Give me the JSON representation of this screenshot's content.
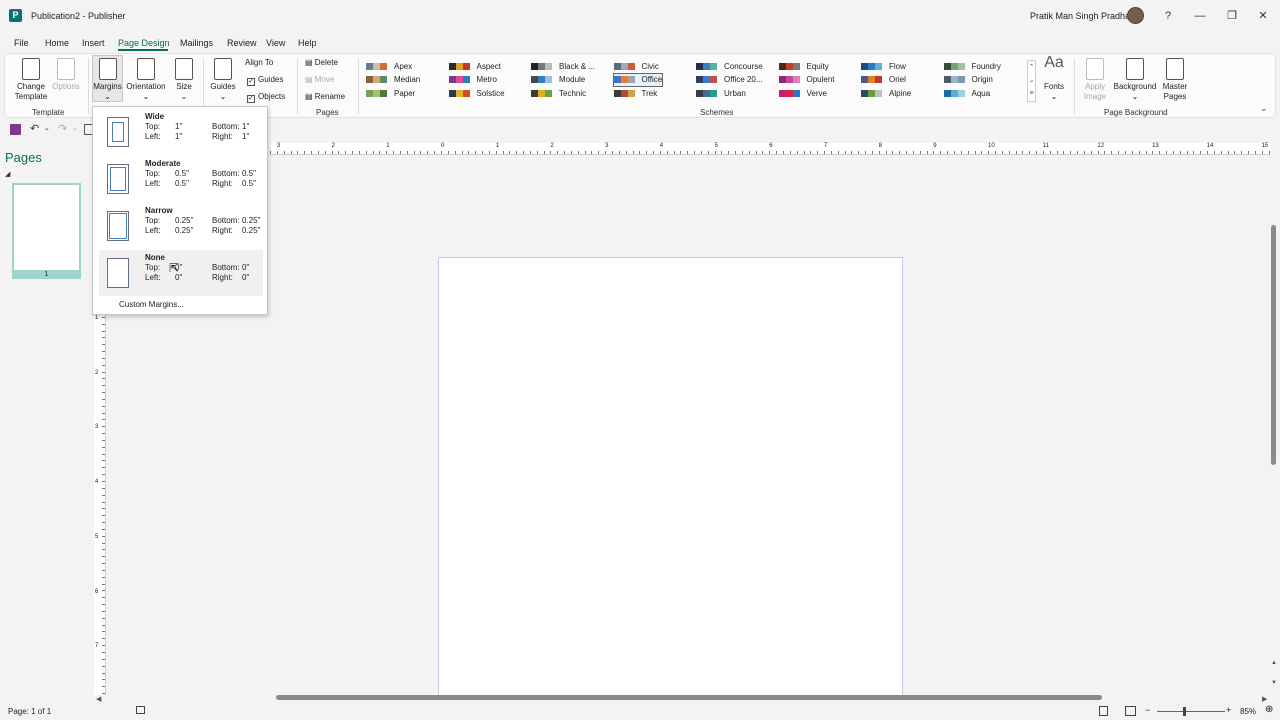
{
  "title_bar": {
    "app_icon_letter": "P",
    "document_title": "Publication2  -  Publisher",
    "user_name": "Pratik Man Singh Pradhan",
    "help": "?",
    "minimize": "—",
    "restore": "❐",
    "close": "✕"
  },
  "menu": {
    "file": "File",
    "home": "Home",
    "insert": "Insert",
    "page_design": "Page Design",
    "mailings": "Mailings",
    "review": "Review",
    "view": "View",
    "help": "Help"
  },
  "ribbon": {
    "template_group": "Template",
    "change_template": "Change Template",
    "options": "Options",
    "margins": "Margins",
    "orientation": "Orientation",
    "size": "Size",
    "guides": "Guides",
    "align_to": "Align To",
    "align_guides": "Guides",
    "align_objects": "Objects",
    "delete": "Delete",
    "move": "Move",
    "rename": "Rename",
    "pages_group": "Pages",
    "schemes_group": "Schemes",
    "fonts": "Fonts",
    "apply_image": "Apply Image",
    "background": "Background",
    "master_pages": "Master Pages",
    "page_background_group": "Page Background",
    "schemes": [
      {
        "name": "Apex",
        "colors": [
          "#6f7a8a",
          "#c9c1a7",
          "#d46b3a"
        ]
      },
      {
        "name": "Median",
        "colors": [
          "#8b5e3c",
          "#d6a96b",
          "#5a8b6e"
        ]
      },
      {
        "name": "Paper",
        "colors": [
          "#7aa05a",
          "#a6c16b",
          "#4e7a3a"
        ]
      },
      {
        "name": "Aspect",
        "colors": [
          "#2b2b2b",
          "#e0a020",
          "#c0392b"
        ]
      },
      {
        "name": "Metro",
        "colors": [
          "#7a3b8f",
          "#e04a9b",
          "#2c7ab8"
        ]
      },
      {
        "name": "Solstice",
        "colors": [
          "#2f3b4a",
          "#e8b030",
          "#d0502a"
        ]
      },
      {
        "name": "Black & ...",
        "colors": [
          "#222222",
          "#777777",
          "#bbbbbb"
        ]
      },
      {
        "name": "Module",
        "colors": [
          "#4a4a4a",
          "#2f7fbf",
          "#9fc0e0"
        ]
      },
      {
        "name": "Technic",
        "colors": [
          "#3a3a3a",
          "#e0b020",
          "#6aa040"
        ]
      },
      {
        "name": "Civic",
        "colors": [
          "#5a6a7a",
          "#9aaaba",
          "#c95a3a"
        ]
      },
      {
        "name": "Office",
        "colors": [
          "#4472c4",
          "#ed7d31",
          "#a5a5a5"
        ]
      },
      {
        "name": "Trek",
        "colors": [
          "#3a3a3a",
          "#b04a2a",
          "#d0a050"
        ]
      },
      {
        "name": "Concourse",
        "colors": [
          "#2a2a4a",
          "#3a7abf",
          "#5ab0a0"
        ]
      },
      {
        "name": "Office 20...",
        "colors": [
          "#2f3f5f",
          "#3c78d8",
          "#c0504d"
        ]
      },
      {
        "name": "Urban",
        "colors": [
          "#3a3a4a",
          "#4a6a9a",
          "#2a9a8a"
        ]
      },
      {
        "name": "Equity",
        "colors": [
          "#4a2a1a",
          "#c0402a",
          "#7a7a7a"
        ]
      },
      {
        "name": "Opulent",
        "colors": [
          "#8a2a7a",
          "#c04a9a",
          "#e07ac0"
        ]
      },
      {
        "name": "Verve",
        "colors": [
          "#c0207a",
          "#e02040",
          "#2a7abf"
        ]
      },
      {
        "name": "Flow",
        "colors": [
          "#1a4a8a",
          "#2a7abf",
          "#5ab0e0"
        ]
      },
      {
        "name": "Oriel",
        "colors": [
          "#4a5a8a",
          "#e0802a",
          "#c03a2a"
        ]
      },
      {
        "name": "Alpine",
        "colors": [
          "#2a4a6a",
          "#6a9a3a",
          "#c0c0c0"
        ]
      },
      {
        "name": "Foundry",
        "colors": [
          "#3a4a3a",
          "#7aa07a",
          "#a0c0a0"
        ]
      },
      {
        "name": "Origin",
        "colors": [
          "#4a5a6a",
          "#a0b0c0",
          "#7a9ab0"
        ]
      },
      {
        "name": "Aqua",
        "colors": [
          "#1a6a9a",
          "#5ab0d0",
          "#a0d0e0"
        ]
      }
    ]
  },
  "pages_pane": {
    "title": "Pages",
    "thumbnail_number": "1"
  },
  "margins_dropdown": {
    "options": [
      {
        "name": "Wide",
        "top_label": "Top:",
        "top": "1\"",
        "left_label": "Left:",
        "left": "1\"",
        "bottom_label": "Bottom:",
        "bottom": "1\"",
        "right_label": "Right:",
        "right": "1\""
      },
      {
        "name": "Moderate",
        "top_label": "Top:",
        "top": "0.5\"",
        "left_label": "Left:",
        "left": "0.5\"",
        "bottom_label": "Bottom:",
        "bottom": "0.5\"",
        "right_label": "Right:",
        "right": "0.5\""
      },
      {
        "name": "Narrow",
        "top_label": "Top:",
        "top": "0.25\"",
        "left_label": "Left:",
        "left": "0.25\"",
        "bottom_label": "Bottom:",
        "bottom": "0.25\"",
        "right_label": "Right:",
        "right": "0.25\""
      },
      {
        "name": "None",
        "top_label": "Top:",
        "top": "0\"",
        "left_label": "Left:",
        "left": "0\"",
        "bottom_label": "Bottom:",
        "bottom": "0\"",
        "right_label": "Right:",
        "right": "0\""
      }
    ],
    "custom": "Custom Margins..."
  },
  "rulers": {
    "top_labels": [
      "3",
      "2",
      "1",
      "0",
      "1",
      "2",
      "3",
      "4",
      "5",
      "6",
      "7",
      "8",
      "9",
      "10",
      "11",
      "12",
      "13",
      "14",
      "15"
    ],
    "left_labels": [
      "1",
      "2",
      "3",
      "4",
      "5",
      "6",
      "7"
    ]
  },
  "status_bar": {
    "page_info": "Page: 1 of 1",
    "zoom": "85%"
  }
}
